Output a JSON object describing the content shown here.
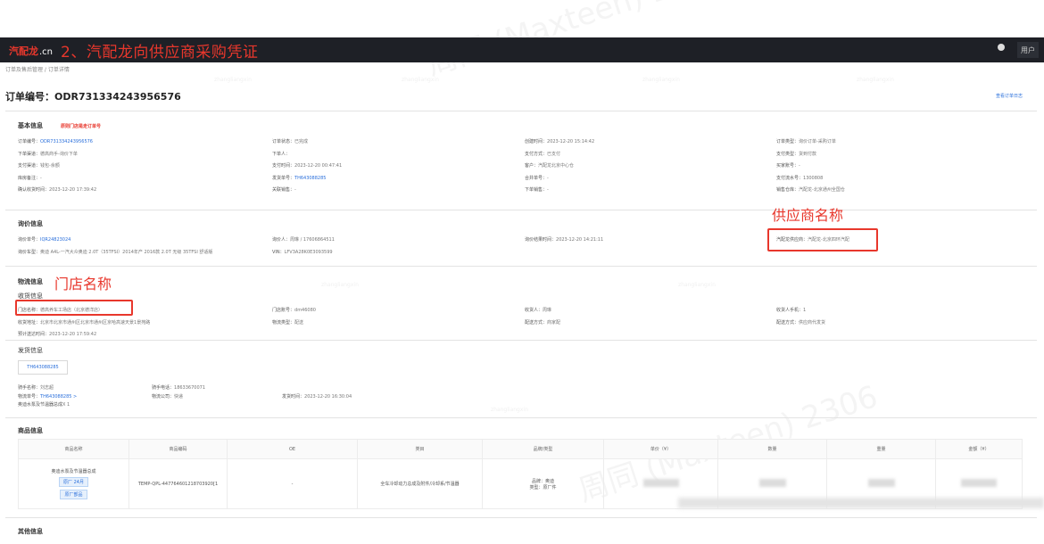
{
  "header": {
    "logo_text": "汽配龙",
    "logo_suffix": ".cn",
    "banner": "2、汽配龙向供应商采购凭证",
    "user_button": "用户"
  },
  "breadcrumb": {
    "text": "订单及售后管理 / 订单详情"
  },
  "order": {
    "title": "订单编号：ODR731334243956576",
    "record_link": "查看订单日志"
  },
  "basic": {
    "title": "基本信息",
    "red_note": "原则门店是走订单号",
    "rows": [
      [
        [
          "订单编号：",
          "ODR731334243956576"
        ],
        [
          "订单状态：",
          "已完成"
        ],
        [
          "创建时间：",
          "2023-12-20 15:14:42"
        ],
        [
          "订单类型：",
          "询价订单-采购订单"
        ]
      ],
      [
        [
          "下单渠道：",
          "德高商手-询价下单"
        ],
        [
          "下单人：",
          ""
        ],
        [
          "支付方式：",
          "已支付"
        ],
        [
          "支付类型：",
          "货到付款"
        ]
      ],
      [
        [
          "支付渠道：",
          "钱包-余额"
        ],
        [
          "支付时间：",
          "2023-12-20 00:47:41"
        ],
        [
          "客户：",
          "汽配龙北京中心仓"
        ],
        [
          "买家账号：",
          "-"
        ]
      ],
      [
        [
          "库房备注：",
          "-"
        ],
        [
          "发货单号：",
          "TH643088285"
        ],
        [
          "合并单号：",
          "-"
        ],
        [
          "支付流水号：",
          "1300808"
        ]
      ],
      [
        [
          "确认收货时间：",
          "2023-12-20 17:39:42"
        ],
        [
          "关联销售：",
          "-"
        ],
        [
          "下单销售：",
          "-"
        ],
        [
          "销售仓库：",
          "汽配龙-北京通州全国仓"
        ]
      ]
    ]
  },
  "inquiry": {
    "title": "询价信息",
    "rows": [
      [
        [
          "询价单号：",
          "IQR24823024"
        ],
        [
          "询价人：",
          "周琳 / 17606864511"
        ],
        [
          "询价结果时间：",
          "2023-12-20 14:21:11"
        ],
        [
          "汽配龙供应商：",
          "汽配龙-北京四环汽配"
        ]
      ],
      [
        [
          "询价车型：",
          "奥迪 A4L-一汽大众奥迪 2.0T（35TFSI）2014年产 2016款 2.0T 无级 35TFSI 舒适版"
        ],
        [
          "VIN：",
          "LFV3A28K0E3093599"
        ],
        [
          "",
          ""
        ],
        [
          "",
          ""
        ]
      ]
    ]
  },
  "logistics": {
    "title": "物流信息",
    "receive_title": "收货信息",
    "rows": [
      [
        [
          "门店名称：",
          "德高养车工场店（北京德洋店）"
        ],
        [
          "门店账号：",
          "dm46080"
        ],
        [
          "收货人：",
          "周琳"
        ],
        [
          "收货人手机：",
          "1"
        ]
      ],
      [
        [
          "收货地址：",
          "北京市北京市通州区北京市通州区京哈高速天景1景苑路"
        ],
        [
          "物流类型：",
          "配送"
        ],
        [
          "配送方式：",
          "商家配"
        ],
        [
          "配送方式：",
          "供应商代发货"
        ]
      ],
      [
        [
          "预计送达时间：",
          "2023-12-20 17:59:42"
        ],
        [
          "",
          ""
        ],
        [
          "",
          ""
        ],
        [
          "",
          ""
        ]
      ]
    ],
    "ship_title": "发货信息",
    "ship_tab": "TH643088285",
    "ship_rows": [
      [
        [
          "骑手名称：",
          "刘志超"
        ],
        [
          "骑手电话：",
          "18633670071"
        ],
        [
          "",
          ""
        ]
      ],
      [
        [
          "物流单号：",
          "TH643088285 >"
        ],
        [
          "物流公司：",
          "快递"
        ],
        [
          "发货时间：",
          "2023-12-20 16:30:04"
        ]
      ],
      [
        [
          "奥迪水泵及节温器总成",
          "X 1"
        ],
        [
          "",
          ""
        ],
        [
          "",
          ""
        ]
      ]
    ]
  },
  "annotations": {
    "supplier": "供应商名称",
    "store": "门店名称"
  },
  "goods": {
    "title": "商品信息",
    "headers": [
      "商品名称",
      "商品编码",
      "OE",
      "类目",
      "品牌/类型",
      "单价（¥）",
      "数量",
      "重量",
      "金额（¥）"
    ],
    "row": {
      "name": "奥迪水泵及节温器总成",
      "tag1": "原厂 24月",
      "tag2": "原厂部品",
      "code": "TEMP-QPL-447764601218703920[1",
      "oe": "-",
      "category": "全车冷却动力总成及附件/冷却系/节温器",
      "brand": "品牌：奥迪",
      "type": "类型：原厂件"
    }
  },
  "other": {
    "title": "其他信息"
  },
  "watermark": {
    "big": "周同 (Maxteen) 2306",
    "small": "zhangliangxin"
  }
}
